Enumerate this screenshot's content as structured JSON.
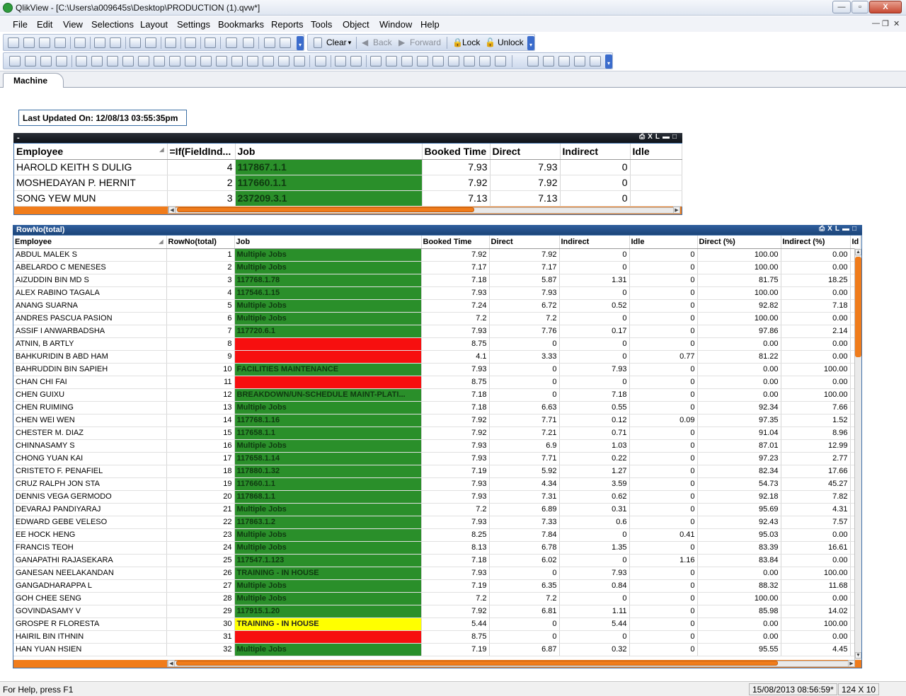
{
  "window": {
    "title": "QlikView - [C:\\Users\\a009645s\\Desktop\\PRODUCTION (1).qvw*]",
    "minimize": "—",
    "maximize": "▫",
    "close": "X"
  },
  "menu": [
    "File",
    "Edit",
    "View",
    "Selections",
    "Layout",
    "Settings",
    "Bookmarks",
    "Reports",
    "Tools",
    "Object",
    "Window",
    "Help"
  ],
  "toolbar": {
    "clear": "Clear",
    "back": "Back",
    "forward": "Forward",
    "lock": "Lock",
    "unlock": "Unlock"
  },
  "tabs": [
    "Machine"
  ],
  "last_updated": "Last Updated On: 12/08/13 03:55:35pm",
  "table1": {
    "caption": "-",
    "headers": [
      "Employee",
      "=If(FieldInd...",
      "Job",
      "Booked Time",
      "Direct",
      "Indirect",
      "Idle"
    ],
    "rows": [
      [
        "HAROLD KEITH S DULIG",
        "4",
        "117867.1.1",
        "7.93",
        "7.93",
        "0",
        ""
      ],
      [
        "MOSHEDAYAN P. HERNIT",
        "2",
        "117660.1.1",
        "7.92",
        "7.92",
        "0",
        ""
      ],
      [
        "SONG YEW MUN",
        "3",
        "237209.3.1",
        "7.13",
        "7.13",
        "0",
        ""
      ]
    ]
  },
  "table2": {
    "caption": "RowNo(total)",
    "headers": [
      "Employee",
      "RowNo(total)",
      "Job",
      "Booked Time",
      "Direct",
      "Indirect",
      "Idle",
      "Direct (%)",
      "Indirect (%)",
      "Id"
    ],
    "rows": [
      [
        "ABDUL MALEK S",
        "1",
        "Multiple Jobs",
        "7.92",
        "7.92",
        "0",
        "0",
        "100.00",
        "0.00",
        "green"
      ],
      [
        "ABELARDO C MENESES",
        "2",
        "Multiple Jobs",
        "7.17",
        "7.17",
        "0",
        "0",
        "100.00",
        "0.00",
        "green"
      ],
      [
        "AIZUDDIN BIN MD S",
        "3",
        "117768.1.78",
        "7.18",
        "5.87",
        "1.31",
        "0",
        "81.75",
        "18.25",
        "green"
      ],
      [
        "ALEX RABINO TAGALA",
        "4",
        "117546.1.15",
        "7.93",
        "7.93",
        "0",
        "0",
        "100.00",
        "0.00",
        "green"
      ],
      [
        "ANANG SUARNA",
        "5",
        "Multiple Jobs",
        "7.24",
        "6.72",
        "0.52",
        "0",
        "92.82",
        "7.18",
        "green"
      ],
      [
        "ANDRES PASCUA PASION",
        "6",
        "Multiple Jobs",
        "7.2",
        "7.2",
        "0",
        "0",
        "100.00",
        "0.00",
        "green"
      ],
      [
        "ASSIF I ANWARBADSHA",
        "7",
        "117720.6.1",
        "7.93",
        "7.76",
        "0.17",
        "0",
        "97.86",
        "2.14",
        "green"
      ],
      [
        "ATNIN, B ARTLY",
        "8",
        "",
        "8.75",
        "0",
        "0",
        "0",
        "0.00",
        "0.00",
        "red"
      ],
      [
        "BAHKURIDIN B ABD HAM",
        "9",
        "",
        "4.1",
        "3.33",
        "0",
        "0.77",
        "81.22",
        "0.00",
        "red"
      ],
      [
        "BAHRUDDIN BIN SAPIEH",
        "10",
        "FACILITIES MAINTENANCE",
        "7.93",
        "0",
        "7.93",
        "0",
        "0.00",
        "100.00",
        "green"
      ],
      [
        "CHAN CHI FAI",
        "11",
        "",
        "8.75",
        "0",
        "0",
        "0",
        "0.00",
        "0.00",
        "red"
      ],
      [
        "CHEN GUIXU",
        "12",
        "BREAKDOWN/UN-SCHEDULE MAINT-PLATI...",
        "7.18",
        "0",
        "7.18",
        "0",
        "0.00",
        "100.00",
        "green"
      ],
      [
        "CHEN RUIMING",
        "13",
        "Multiple Jobs",
        "7.18",
        "6.63",
        "0.55",
        "0",
        "92.34",
        "7.66",
        "green"
      ],
      [
        "CHEN WEI WEN",
        "14",
        "117768.1.16",
        "7.92",
        "7.71",
        "0.12",
        "0.09",
        "97.35",
        "1.52",
        "green"
      ],
      [
        "CHESTER M. DIAZ",
        "15",
        "117658.1.1",
        "7.92",
        "7.21",
        "0.71",
        "0",
        "91.04",
        "8.96",
        "green"
      ],
      [
        "CHINNASAMY S",
        "16",
        "Multiple Jobs",
        "7.93",
        "6.9",
        "1.03",
        "0",
        "87.01",
        "12.99",
        "green"
      ],
      [
        "CHONG YUAN KAI",
        "17",
        "117658.1.14",
        "7.93",
        "7.71",
        "0.22",
        "0",
        "97.23",
        "2.77",
        "green"
      ],
      [
        "CRISTETO F. PENAFIEL",
        "18",
        "117880.1.32",
        "7.19",
        "5.92",
        "1.27",
        "0",
        "82.34",
        "17.66",
        "green"
      ],
      [
        "CRUZ RALPH JON STA",
        "19",
        "117660.1.1",
        "7.93",
        "4.34",
        "3.59",
        "0",
        "54.73",
        "45.27",
        "green"
      ],
      [
        "DENNIS VEGA GERMODO",
        "20",
        "117868.1.1",
        "7.93",
        "7.31",
        "0.62",
        "0",
        "92.18",
        "7.82",
        "green"
      ],
      [
        "DEVARAJ PANDIYARAJ",
        "21",
        "Multiple Jobs",
        "7.2",
        "6.89",
        "0.31",
        "0",
        "95.69",
        "4.31",
        "green"
      ],
      [
        "EDWARD GEBE VELESO",
        "22",
        "117863.1.2",
        "7.93",
        "7.33",
        "0.6",
        "0",
        "92.43",
        "7.57",
        "green"
      ],
      [
        "EE HOCK HENG",
        "23",
        "Multiple Jobs",
        "8.25",
        "7.84",
        "0",
        "0.41",
        "95.03",
        "0.00",
        "green"
      ],
      [
        "FRANCIS TEOH",
        "24",
        "Multiple Jobs",
        "8.13",
        "6.78",
        "1.35",
        "0",
        "83.39",
        "16.61",
        "green"
      ],
      [
        "GANAPATHI RAJASEKARA",
        "25",
        "117547.1.123",
        "7.18",
        "6.02",
        "0",
        "1.16",
        "83.84",
        "0.00",
        "green"
      ],
      [
        "GANESAN NEELAKANDAN",
        "26",
        "TRAINING - IN HOUSE",
        "7.93",
        "0",
        "7.93",
        "0",
        "0.00",
        "100.00",
        "green"
      ],
      [
        "GANGADHARAPPA L",
        "27",
        "Multiple Jobs",
        "7.19",
        "6.35",
        "0.84",
        "0",
        "88.32",
        "11.68",
        "green"
      ],
      [
        "GOH CHEE SENG",
        "28",
        "Multiple Jobs",
        "7.2",
        "7.2",
        "0",
        "0",
        "100.00",
        "0.00",
        "green"
      ],
      [
        "GOVINDASAMY V",
        "29",
        "117915.1.20",
        "7.92",
        "6.81",
        "1.11",
        "0",
        "85.98",
        "14.02",
        "green"
      ],
      [
        "GROSPE R FLORESTA",
        "30",
        "TRAINING - IN HOUSE",
        "5.44",
        "0",
        "5.44",
        "0",
        "0.00",
        "100.00",
        "yellow"
      ],
      [
        "HAIRIL BIN ITHNIN",
        "31",
        "",
        "8.75",
        "0",
        "0",
        "0",
        "0.00",
        "0.00",
        "red"
      ],
      [
        "HAN YUAN HSIEN",
        "32",
        "Multiple Jobs",
        "7.19",
        "6.87",
        "0.32",
        "0",
        "95.55",
        "4.45",
        "green"
      ]
    ]
  },
  "status": {
    "help": "For Help, press F1",
    "datetime": "15/08/2013 08:56:59*",
    "dimensions": "124 X 10"
  },
  "colors": {
    "green": "#2a8f2a",
    "red": "#f70f0f",
    "yellow": "#ffff00",
    "scroll_orange": "#f07c1b"
  }
}
